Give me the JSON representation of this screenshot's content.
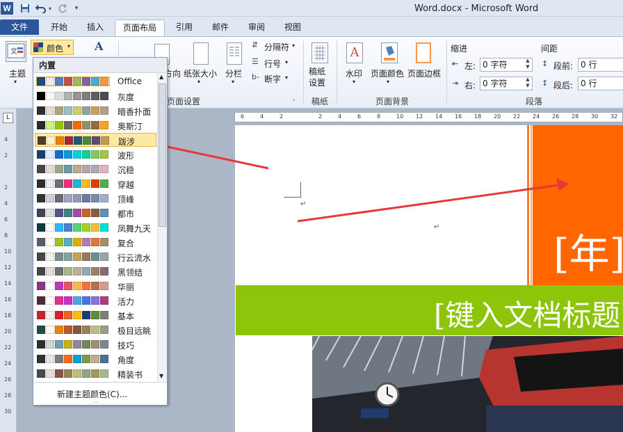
{
  "window": {
    "title": "Word.docx  -  Microsoft Word",
    "word_icon": "W"
  },
  "tabs": [
    {
      "label": "文件",
      "name": "tab-file"
    },
    {
      "label": "开始",
      "name": "tab-home"
    },
    {
      "label": "插入",
      "name": "tab-insert"
    },
    {
      "label": "页面布局",
      "name": "tab-page-layout"
    },
    {
      "label": "引用",
      "name": "tab-references"
    },
    {
      "label": "邮件",
      "name": "tab-mailings"
    },
    {
      "label": "审阅",
      "name": "tab-review"
    },
    {
      "label": "视图",
      "name": "tab-view"
    }
  ],
  "ribbon": {
    "themes": "主题",
    "colors_button": "颜色",
    "orientation": "方向",
    "size": "纸张大小",
    "columns": "分栏",
    "breaks": "分隔符",
    "line_numbers": "行号",
    "hyphenation": "断字",
    "page_setup_group": "页面设置",
    "manuscript": "稿纸设置",
    "manuscript_line1": "稿纸",
    "manuscript_line2": "设置",
    "manuscript_group": "稿纸",
    "watermark": "水印",
    "page_color": "页面颜色",
    "page_borders": "页面边框",
    "page_background_group": "页面背景",
    "indent_label": "缩进",
    "indent_left_label": "左:",
    "indent_left_value": "0 字符",
    "indent_right_label": "右:",
    "indent_right_value": "0 字符",
    "spacing_label": "间距",
    "spacing_before_label": "段前:",
    "spacing_before_value": "0 行",
    "spacing_after_label": "段后:",
    "spacing_after_value": "0 行",
    "paragraph_group": "段落"
  },
  "colors_dropdown": {
    "header": "内置",
    "items": [
      {
        "label": "Office",
        "colors": [
          "#1f497d",
          "#eeece1",
          "#4f81bd",
          "#c0504d",
          "#9bbb59",
          "#8064a2",
          "#4bacc6",
          "#f79646"
        ]
      },
      {
        "label": "灰度",
        "colors": [
          "#000000",
          "#f8f8f8",
          "#dddddd",
          "#b2b2b2",
          "#969696",
          "#808080",
          "#5f5f5f",
          "#4d4d4d"
        ]
      },
      {
        "label": "暗香扑面",
        "colors": [
          "#2f2f2f",
          "#e3ded1",
          "#a9a57c",
          "#9cbebd",
          "#d2cb6c",
          "#95a39d",
          "#c89f5d",
          "#b1a089"
        ]
      },
      {
        "label": "奥斯汀",
        "colors": [
          "#2a2a2a",
          "#caf278",
          "#94c600",
          "#71685a",
          "#ff6700",
          "#909465",
          "#956b43",
          "#fea022"
        ]
      },
      {
        "label": "跋涉",
        "colors": [
          "#4e3b30",
          "#fbeec9",
          "#f07f09",
          "#9f2936",
          "#1b587c",
          "#4e8542",
          "#604878",
          "#c19859"
        ]
      },
      {
        "label": "波形",
        "colors": [
          "#17406d",
          "#dbefff",
          "#0f6fc6",
          "#009dd9",
          "#0bd0d9",
          "#10cf9b",
          "#7cca62",
          "#a5c249"
        ]
      },
      {
        "label": "沉稳",
        "colors": [
          "#464646",
          "#e3dcd5",
          "#9aa98e",
          "#6a9aa3",
          "#bda98e",
          "#b9a4a6",
          "#ada7ba",
          "#e2b3b8"
        ]
      },
      {
        "label": "穿越",
        "colors": [
          "#2e2e2e",
          "#e7ecf3",
          "#6f6f74",
          "#ee2e7a",
          "#1eb5d6",
          "#ffb922",
          "#e03c15",
          "#4db04a"
        ]
      },
      {
        "label": "顶峰",
        "colors": [
          "#333333",
          "#cecfd7",
          "#6c6c75",
          "#a4a4c7",
          "#9698b1",
          "#6c7aa9",
          "#7a8aa8",
          "#a0b0c8"
        ]
      },
      {
        "label": "都市",
        "colors": [
          "#424456",
          "#dedede",
          "#53548a",
          "#438086",
          "#a04da3",
          "#c4652d",
          "#8b5d3d",
          "#5c92b5"
        ]
      },
      {
        "label": "凤舞九天",
        "colors": [
          "#0c3c3f",
          "#ffffff",
          "#31b6fd",
          "#4584d3",
          "#5bd078",
          "#a5d028",
          "#f5c040",
          "#05e0db"
        ]
      },
      {
        "label": "复合",
        "colors": [
          "#575f6d",
          "#fffff2",
          "#98c723",
          "#59b0b9",
          "#deae00",
          "#b77bb4",
          "#e0773c",
          "#a98d63"
        ]
      },
      {
        "label": "行云流水",
        "colors": [
          "#474747",
          "#eef2e8",
          "#7a8c8e",
          "#84a59e",
          "#c6a35d",
          "#957a5f",
          "#6b8f8e",
          "#9da4a8"
        ]
      },
      {
        "label": "黑领结",
        "colors": [
          "#46464a",
          "#e3dcd5",
          "#6f6f74",
          "#a7b789",
          "#beae98",
          "#92a9b9",
          "#9c8265",
          "#8d6974"
        ]
      },
      {
        "label": "华丽",
        "colors": [
          "#8b3680",
          "#ffffff",
          "#ba3bbf",
          "#e8526a",
          "#f7ba4b",
          "#f2713f",
          "#ba6f54",
          "#d49b97"
        ]
      },
      {
        "label": "活力",
        "colors": [
          "#4f2b38",
          "#ffffff",
          "#e32d91",
          "#c830cc",
          "#4ea6dc",
          "#4775e7",
          "#8971e1",
          "#b33980"
        ]
      },
      {
        "label": "基本",
        "colors": [
          "#c2262d",
          "#f2f2f2",
          "#da1f28",
          "#eb641b",
          "#ffc000",
          "#1f3a6e",
          "#5e8e31",
          "#7f7f7f"
        ]
      },
      {
        "label": "极目远眺",
        "colors": [
          "#1f4e44",
          "#fbf8ef",
          "#e48312",
          "#bd582c",
          "#865640",
          "#9b8357",
          "#c2bc80",
          "#94a088"
        ]
      },
      {
        "label": "技巧",
        "colors": [
          "#2e2e2e",
          "#d3d3d3",
          "#6ea0b0",
          "#ccaf0a",
          "#8d89a4",
          "#748560",
          "#9e9273",
          "#7e848d"
        ]
      },
      {
        "label": "角度",
        "colors": [
          "#323232",
          "#e5e5e5",
          "#797b7e",
          "#f96a1b",
          "#08a1d9",
          "#7c984a",
          "#c2ad8d",
          "#506e94"
        ]
      },
      {
        "label": "精装书",
        "colors": [
          "#45484c",
          "#e2dfd8",
          "#865640",
          "#9b8357",
          "#c2bc80",
          "#94a088",
          "#a7955e",
          "#a9b88e"
        ]
      }
    ],
    "new_theme_colors": "新建主题颜色(C)..."
  },
  "document": {
    "year_placeholder": "[年]",
    "title_placeholder": "[键入文档标题]",
    "paragraph_mark": "↵"
  },
  "rulers": {
    "top_ticks": [
      "6",
      "4",
      "2",
      "",
      "2",
      "4",
      "6",
      "8",
      "10",
      "12",
      "14",
      "16",
      "18",
      "20",
      "22",
      "24",
      "26",
      "28",
      "30",
      "32"
    ],
    "left_ticks": [
      "4",
      "2",
      "",
      "2",
      "4",
      "6",
      "8",
      "10",
      "12",
      "14",
      "16",
      "18",
      "20",
      "22",
      "24",
      "26",
      "28",
      "30"
    ]
  },
  "colors": {
    "accent_blue": "#2b579a",
    "orange_block": "#ff6600",
    "green_band": "#8dc50a",
    "arrow_red": "#e8373a",
    "highlight": "#fde9a3"
  }
}
